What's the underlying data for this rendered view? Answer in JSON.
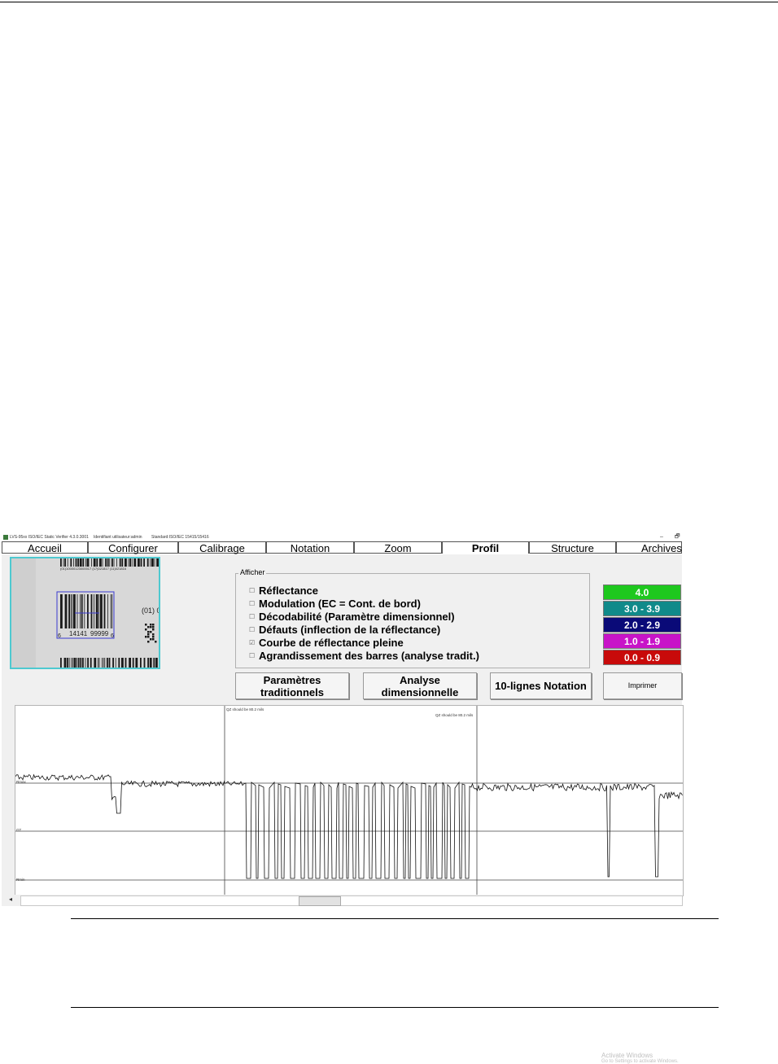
{
  "window": {
    "title": "LVS-95xx ISO/IEC Static Verifier 4.3.0.3001",
    "user": "Identifiant utilisateur:admin",
    "standard": "Standard:ISO/IEC 15415/15416",
    "minimize": "–",
    "restore": "🗗"
  },
  "tabs": [
    {
      "label": "Accueil"
    },
    {
      "label": "Configurer"
    },
    {
      "label": "Calibrage"
    },
    {
      "label": "Notation"
    },
    {
      "label": "Zoom"
    },
    {
      "label": "Profil",
      "active": true
    },
    {
      "label": "Structure"
    },
    {
      "label": "Archives"
    }
  ],
  "thumbnail": {
    "top_text": "(01)10000123000017 (17)021817 (11)021816",
    "side_text": "(01) 0",
    "hri_left": "6",
    "hri_main": "14141",
    "hri_main2": "99999",
    "hri_right": "6"
  },
  "afficher": {
    "legend": "Afficher",
    "options": [
      {
        "label": "Réflectance",
        "checked": false
      },
      {
        "label": "Modulation (EC = Cont. de bord)",
        "checked": false
      },
      {
        "label": "Décodabilité (Paramètre dimensionnel)",
        "checked": false
      },
      {
        "label": "Défauts (inflection de la réflectance)",
        "checked": false
      },
      {
        "label": "Courbe de réflectance pleine",
        "checked": true
      },
      {
        "label": "Agrandissement des barres (analyse tradit.)",
        "checked": false
      }
    ],
    "unchecked_glyph": "☐",
    "checked_glyph": "☑"
  },
  "grades": [
    {
      "label": "4.0",
      "color": "#1ec81e"
    },
    {
      "label": "3.0 - 3.9",
      "color": "#108a8a"
    },
    {
      "label": "2.0 - 2.9",
      "color": "#0a0a78"
    },
    {
      "label": "1.0 - 1.9",
      "color": "#c813c8"
    },
    {
      "label": "0.0 - 0.9",
      "color": "#c80a0a"
    }
  ],
  "buttons": {
    "traditional": "Paramètres\ntraditionnels",
    "dimensional": "Analyse\ndimensionnelle",
    "ten_line": "10-lignes Notation",
    "print": "Imprimer"
  },
  "profile": {
    "qz_left": "QZ should be 80.2 mils",
    "qz_right": "QZ should be 80.2 mils",
    "rmax": "Rmax",
    "gt": "GT",
    "rmin": "Rmin"
  },
  "watermark": {
    "line1": "Activate Windows",
    "line2": "Go to Settings to activate Windows."
  }
}
